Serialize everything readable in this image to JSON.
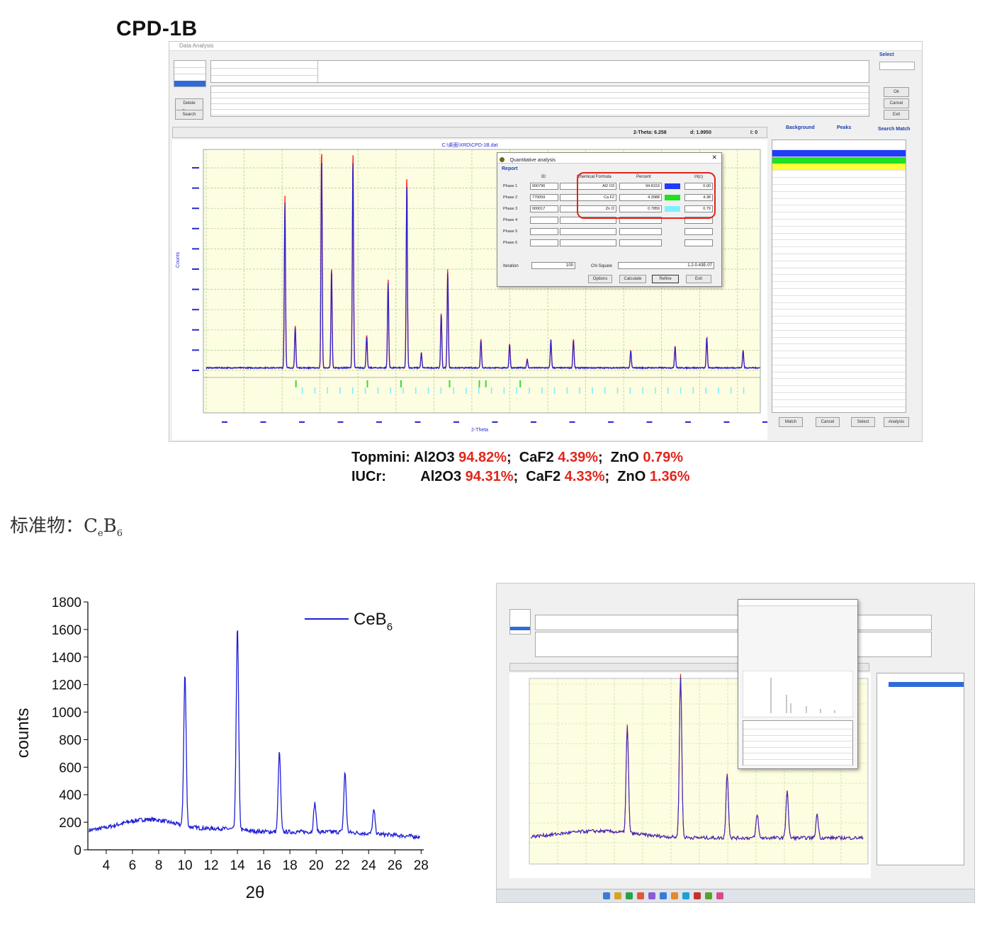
{
  "heading": "CPD-1B",
  "top_window": {
    "title": "Data Analysis",
    "plot_title": "C:\\桌面\\XRD\\CPD-1B.dat",
    "readout": {
      "twotheta": "2-Theta: 6.258",
      "d": "d: 1.9950",
      "h": "I: 0"
    },
    "tabs": [
      "Background",
      "Peaks",
      "Search Match"
    ],
    "buttons_left": [
      "Delete Phases",
      "Search"
    ],
    "buttons_right": [
      "Ok",
      "Cancel",
      "Exit"
    ],
    "buttons_bottom": [
      "Match",
      "Cancel",
      "Select",
      "Analysis"
    ],
    "select_label": "Select",
    "ylabel": "Counts",
    "xlabel": "2-Theta",
    "dialog": {
      "title": "Quantitative analysis",
      "section": "Report",
      "col_id": "ID",
      "col_formula": "Chemical Formula",
      "col_percent": "Percent",
      "col_ratio": "I/I(c)",
      "rows": [
        {
          "label": "Phase 1",
          "id": "000796",
          "formula": "Al2 O3",
          "percent": "94.8153",
          "ratio": "0.00",
          "color": "#1e3cff"
        },
        {
          "label": "Phase 2",
          "id": "770059",
          "formula": "Ca F2",
          "percent": "4.3988",
          "ratio": "4.38",
          "color": "#22e022"
        },
        {
          "label": "Phase 3",
          "id": "000017",
          "formula": "Zn O",
          "percent": "0.7859",
          "ratio": "0.79",
          "color": "#7fefff"
        },
        {
          "label": "Phase 4",
          "id": "",
          "formula": "",
          "percent": "",
          "ratio": "",
          "color": ""
        },
        {
          "label": "Phase 5",
          "id": "",
          "formula": "",
          "percent": "",
          "ratio": "",
          "color": ""
        },
        {
          "label": "Phase 6",
          "id": "",
          "formula": "",
          "percent": "",
          "ratio": "",
          "color": ""
        }
      ],
      "iteration_label": "Iteration",
      "iteration_value": "100",
      "chi_label": "Chi Square",
      "chi_value": "1.2-0.43E-07",
      "buttons": [
        "Options",
        "Calculate",
        "Refine",
        "Exit"
      ]
    }
  },
  "summary": {
    "topmini_label": "Topmini:",
    "iucr_label": "IUCr:",
    "phases": [
      "Al2O3",
      "CaF2",
      "ZnO"
    ],
    "topmini_values": [
      "94.82%",
      "4.39%",
      "0.79%"
    ],
    "iucr_values": [
      "94.31%",
      "4.33%",
      "1.36%"
    ],
    "sep": ";"
  },
  "standard": {
    "label": "标准物：C",
    "sub1": "e",
    "mid": "B",
    "sub2": "6"
  },
  "chart_data": [
    {
      "type": "line",
      "title": "",
      "xlabel": "2θ",
      "ylabel": "counts",
      "xlim": [
        2.6,
        28.2
      ],
      "ylim": [
        0,
        1800
      ],
      "xticks": [
        4,
        6,
        8,
        10,
        12,
        14,
        16,
        18,
        20,
        22,
        24,
        26,
        28
      ],
      "yticks": [
        0,
        200,
        400,
        600,
        800,
        1000,
        1200,
        1400,
        1600,
        1800
      ],
      "legend": "top-right",
      "series": [
        {
          "name": "CeB6",
          "legend_main": "CeB",
          "legend_sub": "6",
          "color": "#1f1fd6",
          "peaks": [
            {
              "x": 10.0,
              "y": 1280
            },
            {
              "x": 14.0,
              "y": 1650
            },
            {
              "x": 17.2,
              "y": 760
            },
            {
              "x": 19.9,
              "y": 390
            },
            {
              "x": 22.2,
              "y": 610
            },
            {
              "x": 24.4,
              "y": 350
            }
          ]
        }
      ]
    },
    {
      "type": "line",
      "title": "",
      "xlabel": "2-Theta",
      "ylabel": "Counts",
      "xlim": [
        5,
        100
      ],
      "series": [
        {
          "name": "CPD-1B",
          "color": "#2323d8",
          "peaks": [
            {
              "x": 25.6,
              "y": 0.78
            },
            {
              "x": 28.3,
              "y": 0.19
            },
            {
              "x": 35.2,
              "y": 1.0
            },
            {
              "x": 37.8,
              "y": 0.46
            },
            {
              "x": 43.4,
              "y": 0.98
            },
            {
              "x": 47.0,
              "y": 0.15
            },
            {
              "x": 52.6,
              "y": 0.4
            },
            {
              "x": 57.5,
              "y": 0.87
            },
            {
              "x": 61.3,
              "y": 0.07
            },
            {
              "x": 66.5,
              "y": 0.25
            },
            {
              "x": 68.2,
              "y": 0.45
            },
            {
              "x": 76.9,
              "y": 0.13
            },
            {
              "x": 84.4,
              "y": 0.11
            },
            {
              "x": 89.0,
              "y": 0.04
            },
            {
              "x": 95.2,
              "y": 0.13
            },
            {
              "x": 101.1,
              "y": 0.13
            },
            {
              "x": 116.1,
              "y": 0.08
            },
            {
              "x": 127.7,
              "y": 0.1
            },
            {
              "x": 136.0,
              "y": 0.14
            },
            {
              "x": 145.5,
              "y": 0.08
            }
          ]
        }
      ]
    }
  ]
}
